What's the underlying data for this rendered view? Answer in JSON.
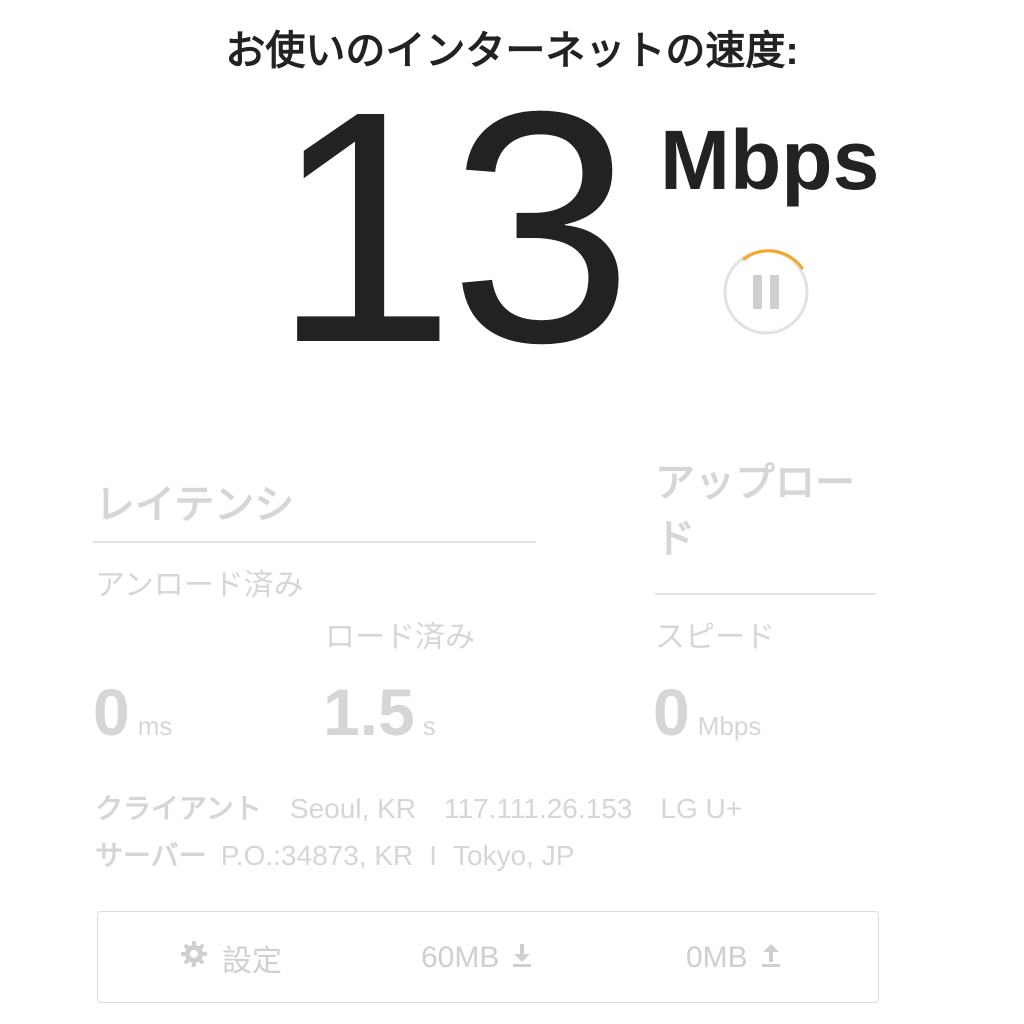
{
  "header": {
    "title": "お使いのインターネットの速度:"
  },
  "speed": {
    "value": "13",
    "unit": "Mbps"
  },
  "controls": {
    "pause_icon": "pause-icon",
    "progress_color": "#f5a623",
    "ring_color": "#e2e2e2"
  },
  "latency": {
    "title": "レイテンシ",
    "unloaded_label": "アンロード済み",
    "unloaded_value": "0",
    "unloaded_unit": "ms",
    "loaded_label": "ロード済み",
    "loaded_value": "1.5",
    "loaded_unit": "s"
  },
  "upload": {
    "title": "アップロード",
    "speed_label": "スピード",
    "speed_value": "0",
    "speed_unit": "Mbps"
  },
  "client": {
    "label": "クライアント",
    "location": "Seoul, KR",
    "ip": "117.111.26.153",
    "isp": "LG U+"
  },
  "server": {
    "label": "サーバー",
    "id": "P.O.:34873, KR",
    "separator": "I",
    "location": "Tokyo, JP"
  },
  "footer": {
    "settings_label": "設定",
    "settings_icon": "gear-icon",
    "download_size": "60MB",
    "download_icon": "download-arrow-icon",
    "upload_size": "0MB",
    "upload_icon": "upload-arrow-icon"
  },
  "colors": {
    "text_dark": "#222222",
    "text_muted": "#d6d6d6",
    "accent": "#f5a623"
  }
}
